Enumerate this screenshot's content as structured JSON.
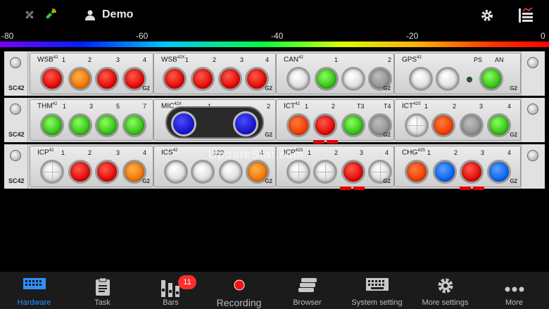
{
  "header": {
    "user_name": "Demo",
    "icons": [
      "fan-icon",
      "satellite-icon",
      "user-icon",
      "gear-icon",
      "rack-icon"
    ]
  },
  "scale": {
    "labels": [
      "-80",
      "-60",
      "-40",
      "-20",
      "0"
    ]
  },
  "rack": {
    "row1": {
      "ear_label": "SC42",
      "modules": [
        {
          "name": "WSB",
          "sup": "42",
          "channels": [
            "1",
            "2",
            "3",
            "4"
          ],
          "tag": "G2"
        },
        {
          "name": "WSB",
          "sup": "42X",
          "channels": [
            "1",
            "2",
            "3",
            "4"
          ],
          "tag": "G2"
        },
        {
          "name": "CAN",
          "sup": "42",
          "channels": [
            "1",
            "2"
          ],
          "tag": "G2"
        },
        {
          "name": "GPS",
          "sup": "42",
          "channels": [
            "PS",
            "AN"
          ],
          "tag": "G2"
        }
      ]
    },
    "row2": {
      "ear_label": "SC42",
      "modules": [
        {
          "name": "THM",
          "sup": "42",
          "channels": [
            "1",
            "3",
            "5",
            "7"
          ],
          "tag": ""
        },
        {
          "name": "MIC",
          "sup": "42X",
          "channels": [
            "1",
            "2"
          ],
          "tag": "G2"
        },
        {
          "name": "ICT",
          "sup": "42",
          "channels": [
            "1",
            "2",
            "T3",
            "T4"
          ],
          "tag": "G2"
        },
        {
          "name": "ICT",
          "sup": "42S",
          "channels": [
            "1",
            "2",
            "3",
            "4"
          ],
          "tag": "G2"
        }
      ]
    },
    "row3": {
      "ear_label": "SC42",
      "modules": [
        {
          "name": "ICP",
          "sup": "42",
          "channels": [
            "1",
            "2",
            "3",
            "4"
          ],
          "tag": "G2"
        },
        {
          "name": "ICS",
          "sup": "42",
          "channels": [
            "123",
            "4"
          ],
          "tag": "G2"
        },
        {
          "name": "ICP",
          "sup": "42S",
          "channels": [
            "1",
            "2",
            "3",
            "4"
          ],
          "tag": "G2"
        },
        {
          "name": "CHG",
          "sup": "42S",
          "channels": [
            "1",
            "2",
            "3",
            "4"
          ],
          "tag": "G2"
        }
      ]
    }
  },
  "watermark": "UpdateStar.com",
  "nav": {
    "items": [
      {
        "label": "Hardware",
        "icon": "keyboard-icon",
        "active": true
      },
      {
        "label": "Task",
        "icon": "clipboard-icon"
      },
      {
        "label": "Bars",
        "icon": "bars-icon",
        "badge": "11"
      },
      {
        "label": "Recording",
        "icon": "record-icon"
      },
      {
        "label": "Browser",
        "icon": "database-icon"
      },
      {
        "label": "System setting",
        "icon": "keyboard-icon"
      },
      {
        "label": "More settings",
        "icon": "gear-icon"
      },
      {
        "label": "More",
        "icon": "more-icon"
      }
    ]
  },
  "colors": {
    "accent": "#2f8fff",
    "badge": "#ff2d2d",
    "record": "#ff1010"
  }
}
